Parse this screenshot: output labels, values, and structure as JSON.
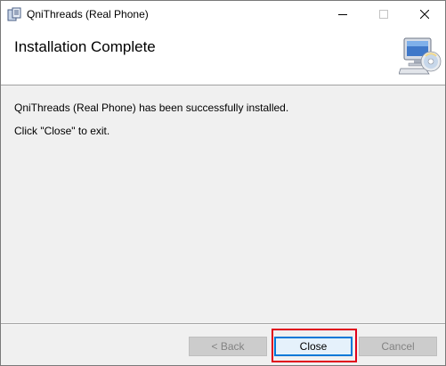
{
  "window": {
    "title": "QniThreads (Real Phone)",
    "controls": {
      "minimize_icon": "minimize-icon",
      "maximize_icon": "maximize-icon",
      "close_icon": "close-icon"
    }
  },
  "header": {
    "title": "Installation Complete",
    "icon": "installer-computer-icon"
  },
  "body": {
    "message": "QniThreads (Real Phone) has been successfully installed.",
    "instruction": "Click \"Close\" to exit."
  },
  "buttons": {
    "back_label": "< Back",
    "close_label": "Close",
    "cancel_label": "Cancel"
  },
  "colors": {
    "dialog_bg": "#f0f0f0",
    "focus_border": "#0078d7",
    "highlight": "#e0001b",
    "disabled_text": "#838383"
  }
}
